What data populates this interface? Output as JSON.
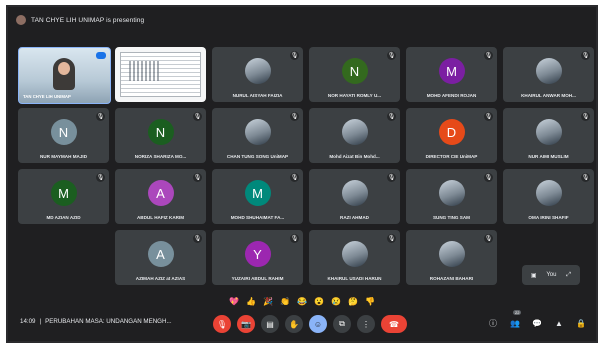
{
  "header": {
    "presenting_text": "TAN CHYE LIH UNIMAP is presenting"
  },
  "participants": [
    {
      "name": "TAN CHYE LIH UNIMAP",
      "initial": "",
      "color": "",
      "type": "presenter-feed"
    },
    {
      "name": "",
      "initial": "",
      "color": "",
      "type": "screen-share"
    },
    {
      "name": "NURUL AISYAH FAIZIA",
      "initial": "",
      "color": "",
      "type": "photo"
    },
    {
      "name": "NOR HAYATI ROMLY U...",
      "initial": "N",
      "color": "#33691e",
      "type": "letter"
    },
    {
      "name": "MOHD AFENDI ROJAN",
      "initial": "M",
      "color": "#7b1fa2",
      "type": "letter"
    },
    {
      "name": "KHAIRUL ANWAR MOH...",
      "initial": "",
      "color": "",
      "type": "photo"
    },
    {
      "name": "NUR MAYMAH MAJID",
      "initial": "N",
      "color": "#78909c",
      "type": "letter"
    },
    {
      "name": "NORIZA SHARIZA MO...",
      "initial": "N",
      "color": "#1b5e20",
      "type": "letter"
    },
    {
      "name": "CHAN TUNG SONG UniMAP",
      "initial": "",
      "color": "",
      "type": "photo"
    },
    {
      "name": "Mohd Aizat Bin Mohd...",
      "initial": "",
      "color": "",
      "type": "photo"
    },
    {
      "name": "DIRECTOR CIE UniMAP",
      "initial": "D",
      "color": "#e64a19",
      "type": "letter"
    },
    {
      "name": "NUR AIMI MUSLIM",
      "initial": "",
      "color": "",
      "type": "photo"
    },
    {
      "name": "MD AZIAN AZID",
      "initial": "M",
      "color": "#1b5e20",
      "type": "letter"
    },
    {
      "name": "ABDUL HAFIZ KARIM",
      "initial": "A",
      "color": "#ab47bc",
      "type": "letter"
    },
    {
      "name": "MOHD SHUHAIMAT FA...",
      "initial": "M",
      "color": "#00897b",
      "type": "letter"
    },
    {
      "name": "RAZI AHMAD",
      "initial": "",
      "color": "",
      "type": "photo"
    },
    {
      "name": "SUNG TING SAM",
      "initial": "",
      "color": "",
      "type": "photo"
    },
    {
      "name": "OMA IRINI SHAFIF",
      "initial": "",
      "color": "",
      "type": "photo"
    },
    {
      "name": "AZIMAH AZIZ at AZIAS",
      "initial": "A",
      "color": "#78909c",
      "type": "letter"
    },
    {
      "name": "YUZAIRI ABDUL RAHIM",
      "initial": "Y",
      "color": "#9c27b0",
      "type": "letter"
    },
    {
      "name": "KHAIRUL USADI HARUN",
      "initial": "",
      "color": "",
      "type": "photo"
    },
    {
      "name": "ROHAZANI BAHARI",
      "initial": "",
      "color": "",
      "type": "photo"
    }
  ],
  "overflow_tile": {
    "label": "You"
  },
  "reactions": [
    "💖",
    "👍",
    "🎉",
    "👏",
    "😂",
    "😮",
    "😢",
    "🤔",
    "👎"
  ],
  "bottom": {
    "time": "14:09",
    "separator": "|",
    "meeting_title": "PERUBAHAN MASA: UNDANGAN MENGH..."
  },
  "controls": [
    {
      "name": "mic-off-button",
      "icon": "mic-off-icon",
      "glyph": "🎙",
      "style": "red"
    },
    {
      "name": "camera-off-button",
      "icon": "camera-off-icon",
      "glyph": "📷",
      "style": "red"
    },
    {
      "name": "captions-button",
      "icon": "captions-icon",
      "glyph": "▤",
      "style": ""
    },
    {
      "name": "raise-hand-button",
      "icon": "hand-icon",
      "glyph": "✋",
      "style": ""
    },
    {
      "name": "reactions-button",
      "icon": "emoji-icon",
      "glyph": "☺",
      "style": "blue"
    },
    {
      "name": "present-button",
      "icon": "present-icon",
      "glyph": "⧉",
      "style": ""
    },
    {
      "name": "more-options-button",
      "icon": "more-vert-icon",
      "glyph": "⋮",
      "style": ""
    },
    {
      "name": "leave-call-button",
      "icon": "hang-up-icon",
      "glyph": "☎",
      "style": "hang"
    }
  ],
  "right_controls": [
    {
      "name": "meeting-details-button",
      "icon": "info-icon",
      "glyph": "ⓘ",
      "count": ""
    },
    {
      "name": "people-button",
      "icon": "people-icon",
      "glyph": "👥",
      "count": "22"
    },
    {
      "name": "chat-button",
      "icon": "chat-icon",
      "glyph": "💬",
      "count": ""
    },
    {
      "name": "activities-button",
      "icon": "shapes-icon",
      "glyph": "▲",
      "count": ""
    },
    {
      "name": "host-controls-button",
      "icon": "lock-person-icon",
      "glyph": "🔒",
      "count": ""
    }
  ]
}
